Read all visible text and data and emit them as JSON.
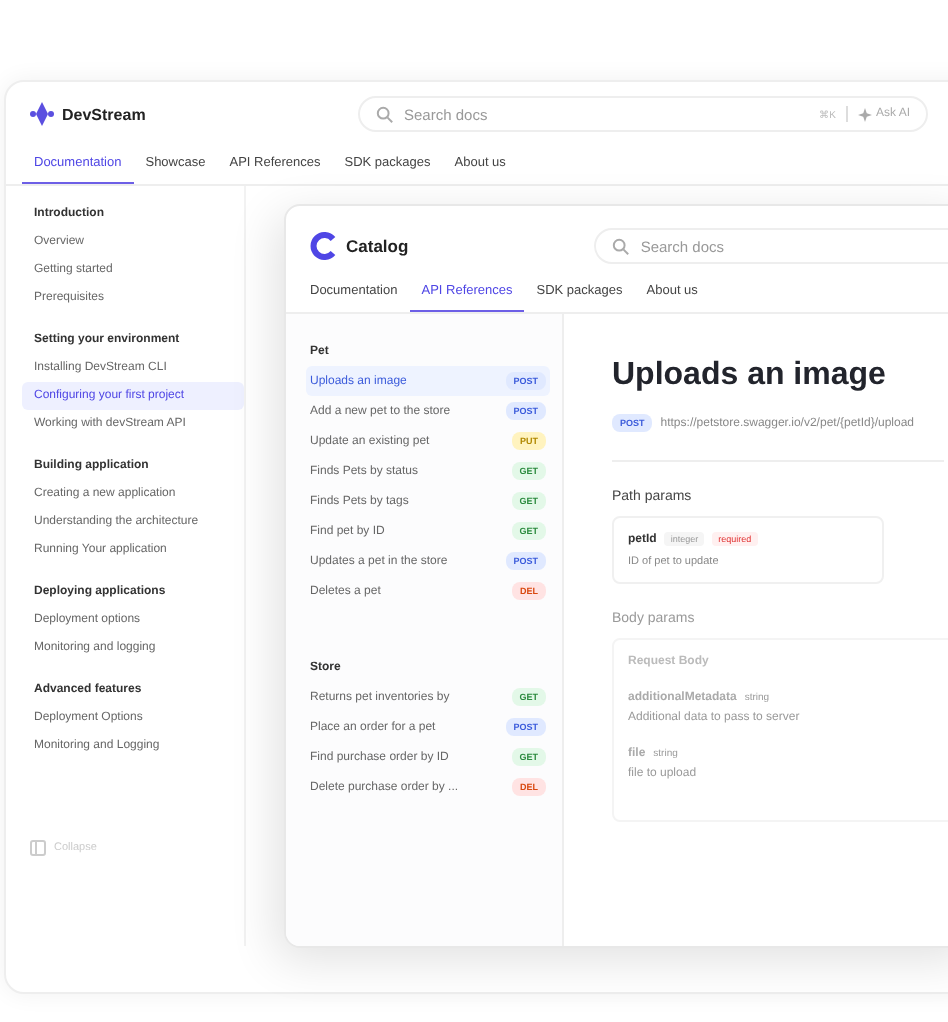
{
  "app": {
    "name": "DevStream",
    "search_placeholder": "Search docs",
    "shortcut": "⌘K",
    "ask_ai": "Ask AI"
  },
  "nav_tabs": [
    {
      "label": "Documentation",
      "selected": true
    },
    {
      "label": "Showcase",
      "selected": false
    },
    {
      "label": "API References",
      "selected": false
    },
    {
      "label": "SDK packages",
      "selected": false
    },
    {
      "label": "About us",
      "selected": false
    }
  ],
  "sidebar": {
    "sections": [
      {
        "title": "Introduction",
        "items": [
          {
            "label": "Overview",
            "selected": false
          },
          {
            "label": "Getting started",
            "selected": false
          },
          {
            "label": "Prerequisites",
            "selected": false
          }
        ]
      },
      {
        "title": "Setting your environment",
        "items": [
          {
            "label": "Installing DevStream CLI",
            "selected": false
          },
          {
            "label": "Configuring your first project",
            "selected": true
          },
          {
            "label": "Working with devStream API",
            "selected": false
          }
        ]
      },
      {
        "title": "Building application",
        "items": [
          {
            "label": "Creating a new application",
            "selected": false
          },
          {
            "label": "Understanding the architecture",
            "selected": false
          },
          {
            "label": "Running Your application",
            "selected": false
          }
        ]
      },
      {
        "title": "Deploying applications",
        "items": [
          {
            "label": "Deployment options",
            "selected": false
          },
          {
            "label": "Monitoring and logging",
            "selected": false
          }
        ]
      },
      {
        "title": "Advanced features",
        "items": [
          {
            "label": "Deployment Options",
            "selected": false
          },
          {
            "label": "Monitoring and Logging",
            "selected": false
          }
        ]
      }
    ],
    "collapse": "Collapse"
  },
  "catalog": {
    "title": "Catalog",
    "search_placeholder": "Search docs",
    "tabs": [
      {
        "label": "Documentation",
        "selected": false
      },
      {
        "label": "API References",
        "selected": true
      },
      {
        "label": "SDK packages",
        "selected": false
      },
      {
        "label": "About us",
        "selected": false
      }
    ],
    "sections": [
      {
        "title": "Pet",
        "items": [
          {
            "label": "Uploads an image",
            "method": "POST",
            "kind": "post",
            "selected": true
          },
          {
            "label": "Add a new pet to the store",
            "method": "POST",
            "kind": "post",
            "selected": false
          },
          {
            "label": "Update an existing pet",
            "method": "PUT",
            "kind": "put",
            "selected": false
          },
          {
            "label": "Finds Pets by status",
            "method": "GET",
            "kind": "get",
            "selected": false
          },
          {
            "label": "Finds Pets by tags",
            "method": "GET",
            "kind": "get",
            "selected": false
          },
          {
            "label": "Find pet by ID",
            "method": "GET",
            "kind": "get",
            "selected": false
          },
          {
            "label": "Updates a pet in the store",
            "method": "POST",
            "kind": "post",
            "selected": false
          },
          {
            "label": "Deletes a pet",
            "method": "DEL",
            "kind": "del",
            "selected": false
          }
        ]
      },
      {
        "title": "Store",
        "items": [
          {
            "label": "Returns pet inventories by",
            "method": "GET",
            "kind": "get",
            "selected": false
          },
          {
            "label": "Place an order for a pet",
            "method": "POST",
            "kind": "post",
            "selected": false
          },
          {
            "label": "Find purchase order by ID",
            "method": "GET",
            "kind": "get",
            "selected": false
          },
          {
            "label": "Delete purchase order by ...",
            "method": "DEL",
            "kind": "del",
            "selected": false
          }
        ]
      }
    ],
    "endpoint": {
      "title": "Uploads an image",
      "method": "POST",
      "kind": "post",
      "url": "https://petstore.swagger.io/v2/pet/{petId}/upload",
      "path_params_title": "Path params",
      "path_params": [
        {
          "name": "petId",
          "type": "integer",
          "badge": "required",
          "description": "ID of pet to update"
        }
      ],
      "body_params_title": "Body params",
      "request_body": {
        "title": "Request Body",
        "fields": [
          {
            "name": "additionalMetadata",
            "type": "string",
            "description": "Additional data to pass to server"
          },
          {
            "name": "file",
            "type": "string",
            "description": "file to upload"
          }
        ]
      }
    }
  }
}
